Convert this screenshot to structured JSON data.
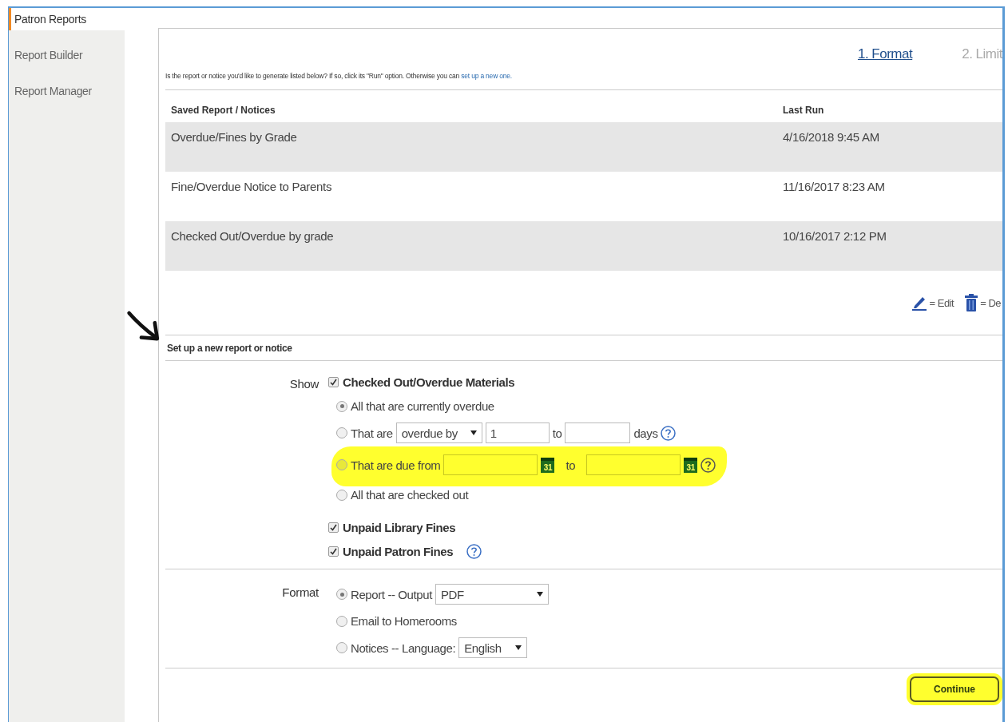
{
  "sidebar": {
    "items": [
      {
        "label": "Patron Reports",
        "selected": true
      },
      {
        "label": "Report Builder",
        "selected": false
      },
      {
        "label": "Report Manager",
        "selected": false
      }
    ]
  },
  "steps": [
    {
      "label": "1. Format",
      "selected": true
    },
    {
      "label": "2. Limit",
      "selected": false
    }
  ],
  "intro": {
    "text": "Is the report or notice you'd like to generate listed below? If so, click its \"Run\" option. Otherwise you can",
    "link": "set up a new one."
  },
  "saved_reports": {
    "columns": [
      "Saved Report / Notices",
      "Last Run"
    ],
    "rows": [
      {
        "name": "Overdue/Fines by Grade",
        "last_run": "4/16/2018 9:45 AM"
      },
      {
        "name": "Fine/Overdue Notice to Parents",
        "last_run": "11/16/2017 8:23 AM"
      },
      {
        "name": "Checked Out/Overdue by grade",
        "last_run": "10/16/2017 2:12 PM"
      }
    ]
  },
  "legend": [
    {
      "kind": "edit",
      "label": "= Edit"
    },
    {
      "kind": "delete",
      "label": "= De"
    }
  ],
  "new_section": {
    "title": "Set up a new report or notice",
    "annotated": true
  },
  "show": {
    "label": "Show",
    "items": [
      {
        "label": "Checked Out/Overdue Materials",
        "checked": true,
        "options": [
          {
            "kind": "plain",
            "label": "All that are currently overdue",
            "selected": true
          },
          {
            "kind": "overdue",
            "label": "That are",
            "select": "overdue by",
            "from": "1",
            "to_label": "to",
            "unit": "days",
            "help": true,
            "selected": false
          },
          {
            "kind": "dates",
            "label": "That are due from",
            "to_label": "to",
            "from_calendar": "31",
            "to_calendar": "31",
            "help": true,
            "highlighted": true,
            "selected": false
          },
          {
            "kind": "plain",
            "label": "All that are checked out",
            "selected": false
          }
        ]
      },
      {
        "label": "Unpaid Library Fines",
        "checked": true
      },
      {
        "label": "Unpaid Patron Fines",
        "checked": true,
        "help": true
      }
    ]
  },
  "format": {
    "label": "Format",
    "options": [
      {
        "kind": "select",
        "label": "Report -- Output",
        "select": "PDF",
        "wide": true,
        "selected": true
      },
      {
        "kind": "plain",
        "label": "Email to Homerooms",
        "selected": false
      },
      {
        "kind": "select",
        "label": "Notices -- Language:",
        "select": "English",
        "wide": false,
        "selected": false
      }
    ]
  },
  "continue_button": {
    "label": "Continue",
    "highlighted": true
  }
}
